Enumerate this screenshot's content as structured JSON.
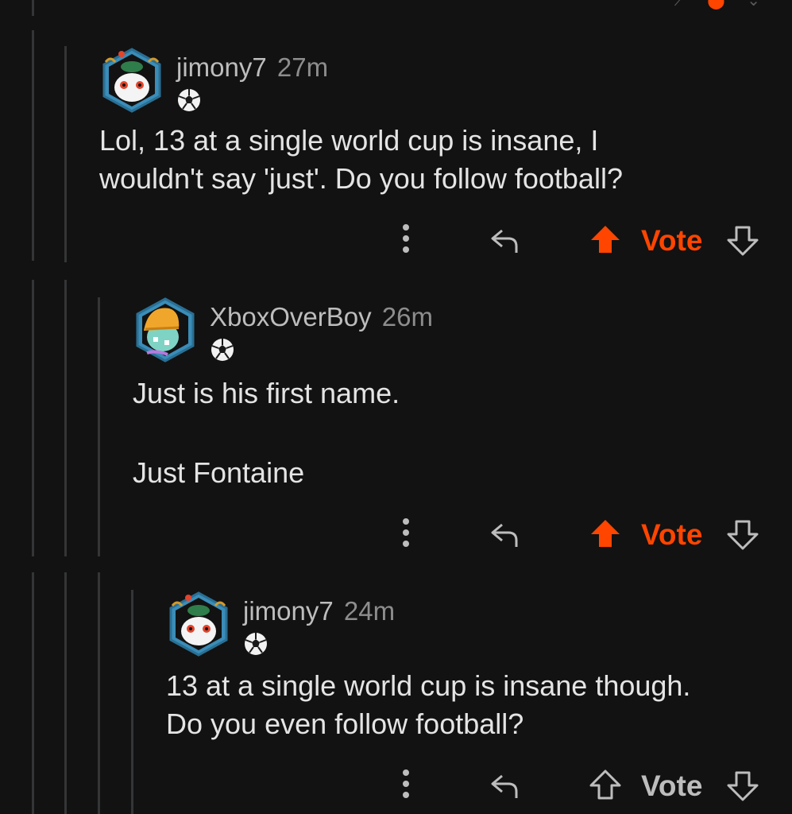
{
  "app": {
    "accent_color": "#ff4500",
    "background": "#121212"
  },
  "top_partial": {
    "icons": [
      "arrow-icon",
      "upvote-icon",
      "downvote-icon"
    ]
  },
  "comments": [
    {
      "username": "jimony7",
      "time": "27m",
      "avatar": "snoo-avatar-white-cat",
      "flair": "soccer-ball-icon",
      "body": "Lol, 13 at a single world cup is insane, I\nwouldn't say 'just'. Do you follow football?",
      "vote_label": "Vote",
      "upvoted": true
    },
    {
      "username": "XboxOverBoy",
      "time": "26m",
      "avatar": "snoo-avatar-beanie",
      "flair": "soccer-ball-icon",
      "body": "Just is his first name.\n\nJust Fontaine",
      "vote_label": "Vote",
      "upvoted": true
    },
    {
      "username": "jimony7",
      "time": "24m",
      "avatar": "snoo-avatar-white-cat",
      "flair": "soccer-ball-icon",
      "body": "13 at a single world cup is insane though.\nDo you even follow football?",
      "vote_label": "Vote",
      "upvoted": false
    }
  ]
}
